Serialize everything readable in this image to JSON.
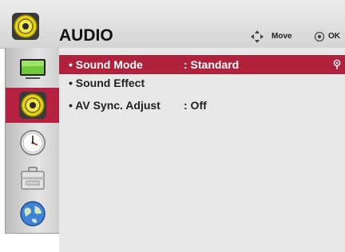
{
  "header": {
    "title": "AUDIO",
    "icon": "speaker-icon",
    "nav_hint": {
      "icon": "four-way-arrows-icon",
      "label": "Move"
    },
    "ok_hint": {
      "icon": "ok-circle-icon",
      "label": "OK"
    }
  },
  "sidebar": {
    "items": [
      {
        "name": "picture",
        "icon": "tv-screen-icon",
        "active": false
      },
      {
        "name": "audio",
        "icon": "speaker-icon",
        "active": true
      },
      {
        "name": "time",
        "icon": "clock-icon",
        "active": false
      },
      {
        "name": "option",
        "icon": "toolbox-icon",
        "active": false
      },
      {
        "name": "network",
        "icon": "globe-icon",
        "active": false
      }
    ]
  },
  "menu": {
    "items": [
      {
        "label": "• Sound Mode",
        "value": ": Standard",
        "selected": true
      },
      {
        "label": "• Sound Effect",
        "value": "",
        "selected": false
      },
      {
        "label": "• AV Sync. Adjust",
        "value": ": Off",
        "selected": false
      }
    ]
  },
  "colors": {
    "accent": "#b0213c",
    "header_bg": "#dcdcdc",
    "content_bg": "#e8e8e8"
  }
}
